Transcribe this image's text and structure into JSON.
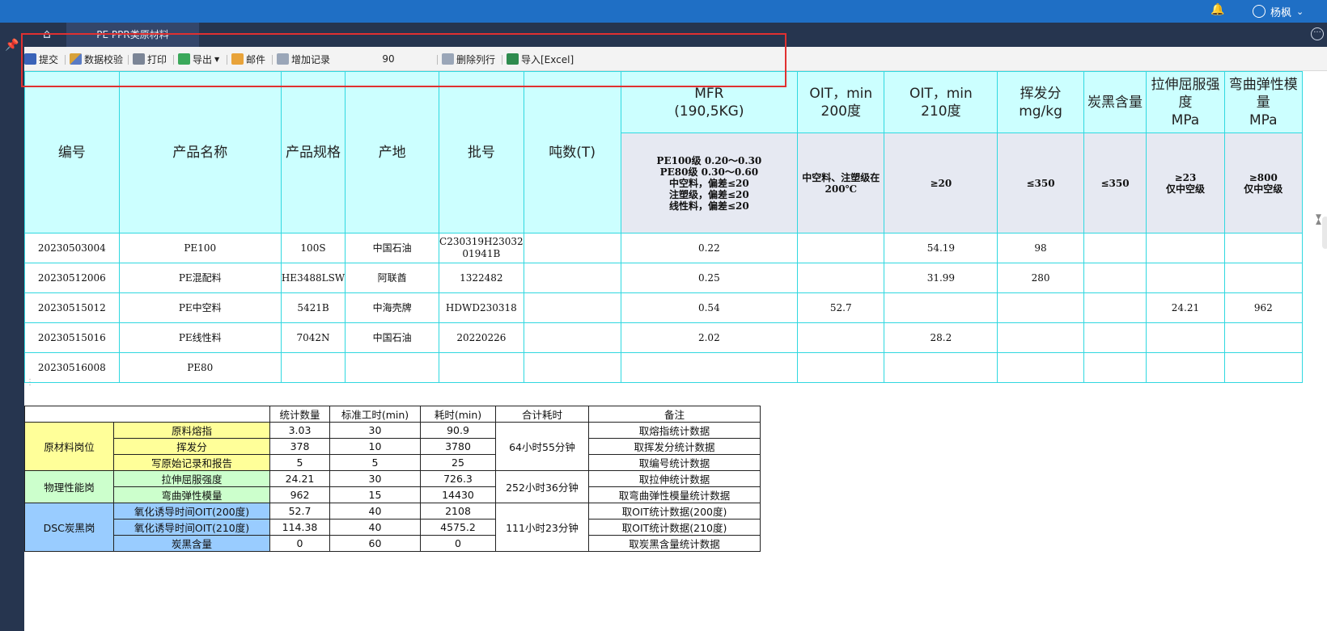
{
  "topbar": {
    "username": "杨枫"
  },
  "tab": {
    "title": "PE PPR类原材料"
  },
  "toolbar": {
    "submit": "提交",
    "validate": "数据校验",
    "print": "打印",
    "export": "导出",
    "mail": "邮件",
    "add_record": "增加记录",
    "row_count": "90",
    "delete_row": "删除列行",
    "import_excel": "导入[Excel]"
  },
  "main_table": {
    "headers": {
      "code": "编号",
      "name": "产品名称",
      "spec": "产品规格",
      "origin": "产地",
      "batch": "批号",
      "tons": "吨数(T)",
      "mfr": [
        "MFR",
        "(190,5KG)"
      ],
      "oit200": [
        "OIT，min",
        "200度"
      ],
      "oit210": [
        "OIT，min",
        "210度"
      ],
      "volatile": [
        "挥发分",
        "mg/kg"
      ],
      "carbon": "炭黑含量",
      "tensile": [
        "拉伸屈服强",
        "度",
        "MPa"
      ],
      "flex": [
        "弯曲弹性模",
        "量",
        "MPa"
      ]
    },
    "requirements": {
      "mfr": [
        "PE100级 0.20～0.30",
        "PE80级 0.30～0.60",
        "中空料，偏差≤20",
        "注塑级，偏差≤20",
        "线性料，偏差≤20"
      ],
      "oit200": [
        "中空料、注塑级在",
        "200℃"
      ],
      "oit210": "≥20",
      "volatile": "≤350",
      "carbon": "≤350",
      "tensile": [
        "≥23",
        "仅中空级"
      ],
      "flex": [
        "≥800",
        "仅中空级"
      ]
    },
    "rows": [
      {
        "code": "20230503004",
        "name": "PE100",
        "spec": "100S",
        "origin": "中国石油",
        "batch": [
          "C230319H23032",
          "01941B"
        ],
        "tons": "",
        "mfr": "0.22",
        "oit200": "",
        "oit210": "54.19",
        "volatile": "98",
        "carbon": "",
        "tensile": "",
        "flex": ""
      },
      {
        "code": "20230512006",
        "name": "PE混配料",
        "spec": "HE3488LSW",
        "origin": "阿联酋",
        "batch": [
          "1322482",
          ""
        ],
        "tons": "",
        "mfr": "0.25",
        "oit200": "",
        "oit210": "31.99",
        "volatile": "280",
        "carbon": "",
        "tensile": "",
        "flex": ""
      },
      {
        "code": "20230515012",
        "name": "PE中空料",
        "spec": "5421B",
        "origin": "中海壳牌",
        "batch": [
          "HDWD230318",
          ""
        ],
        "tons": "",
        "mfr": "0.54",
        "oit200": "52.7",
        "oit210": "",
        "volatile": "",
        "carbon": "",
        "tensile": "24.21",
        "flex": "962"
      },
      {
        "code": "20230515016",
        "name": "PE线性料",
        "spec": "7042N",
        "origin": "中国石油",
        "batch": [
          "20220226",
          ""
        ],
        "tons": "",
        "mfr": "2.02",
        "oit200": "",
        "oit210": "28.2",
        "volatile": "",
        "carbon": "",
        "tensile": "",
        "flex": ""
      },
      {
        "code": "20230516008",
        "name": "PE80",
        "spec": "",
        "origin": "",
        "batch": [
          "",
          ""
        ],
        "tons": "",
        "mfr": "",
        "oit200": "",
        "oit210": "",
        "volatile": "",
        "carbon": "",
        "tensile": "",
        "flex": ""
      }
    ]
  },
  "stats_table": {
    "headers": [
      "统计数量",
      "标准工时(min)",
      "耗时(min)",
      "合计耗时",
      "备注"
    ],
    "groups": [
      {
        "name": "原材料岗位",
        "total": "64小时55分钟",
        "color": "#ffff99",
        "items": [
          {
            "item": "原料熔指",
            "count": "3.03",
            "std": "30",
            "time": "90.9",
            "note": "取熔指统计数据"
          },
          {
            "item": "挥发分",
            "count": "378",
            "std": "10",
            "time": "3780",
            "note": "取挥发分统计数据"
          },
          {
            "item": "写原始记录和报告",
            "count": "5",
            "std": "5",
            "time": "25",
            "note": "取编号统计数据"
          }
        ]
      },
      {
        "name": "物理性能岗",
        "total": "252小时36分钟",
        "color": "#ccffcc",
        "items": [
          {
            "item": "拉伸屈服强度",
            "count": "24.21",
            "std": "30",
            "time": "726.3",
            "note": "取拉伸统计数据"
          },
          {
            "item": "弯曲弹性模量",
            "count": "962",
            "std": "15",
            "time": "14430",
            "note": "取弯曲弹性模量统计数据"
          }
        ]
      },
      {
        "name": "DSC炭黑岗",
        "total": "111小时23分钟",
        "color": "#99ccff",
        "items": [
          {
            "item": "氧化诱导时间OIT(200度)",
            "count": "52.7",
            "std": "40",
            "time": "2108",
            "note": "取OIT统计数据(200度)"
          },
          {
            "item": "氧化诱导时间OIT(210度)",
            "count": "114.38",
            "std": "40",
            "time": "4575.2",
            "note": "取OIT统计数据(210度)"
          },
          {
            "item": "炭黑含量",
            "count": "0",
            "std": "60",
            "time": "0",
            "note": "取炭黑含量统计数据"
          }
        ]
      }
    ]
  }
}
